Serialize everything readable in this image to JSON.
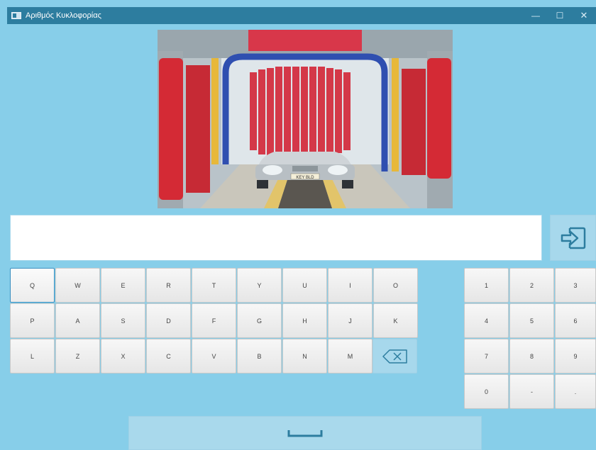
{
  "window": {
    "title": "Αριθμός Κυκλοφορίας",
    "minimize": "—",
    "maximize": "☐",
    "close": "✕"
  },
  "photo": {
    "plate_text": "KEY BLD"
  },
  "plate_input": {
    "value": "",
    "placeholder": ""
  },
  "keyboard": {
    "letters": [
      [
        "Q",
        "W",
        "E",
        "R",
        "T",
        "Y",
        "U",
        "I",
        "O"
      ],
      [
        "P",
        "A",
        "S",
        "D",
        "F",
        "G",
        "H",
        "J",
        "K"
      ],
      [
        "L",
        "Z",
        "X",
        "C",
        "V",
        "B",
        "N",
        "M"
      ]
    ],
    "numpad": [
      [
        "1",
        "2",
        "3"
      ],
      [
        "4",
        "5",
        "6"
      ],
      [
        "7",
        "8",
        "9"
      ],
      [
        "0",
        "-",
        "."
      ]
    ],
    "focused_key": "Q"
  },
  "icons": {
    "app": "app-window-icon",
    "enter": "enter-arrow-icon",
    "backspace": "backspace-icon",
    "space": "space-bar-icon"
  },
  "colors": {
    "background": "#87cee9",
    "titlebar": "#2d7d9f",
    "accent_button": "#a7d8ec",
    "icon_stroke": "#2d7d9f"
  }
}
